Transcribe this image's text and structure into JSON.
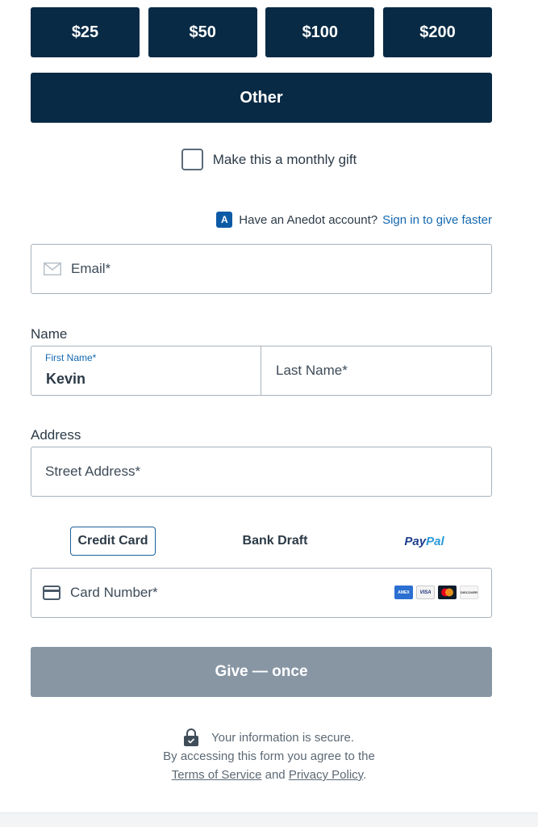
{
  "amounts": [
    "$25",
    "$50",
    "$100",
    "$200"
  ],
  "other_label": "Other",
  "monthly_label": "Make this a monthly gift",
  "account": {
    "badge": "A",
    "prompt": "Have an Anedot account?",
    "signin": "Sign in to give faster"
  },
  "email": {
    "placeholder": "Email*"
  },
  "name": {
    "label": "Name",
    "first_label": "First Name*",
    "first_value": "Kevin",
    "last_placeholder": "Last Name*"
  },
  "address": {
    "label": "Address",
    "street_placeholder": "Street Address*"
  },
  "payment_methods": {
    "credit_card": "Credit Card",
    "bank_draft": "Bank Draft",
    "paypal_pay": "Pay",
    "paypal_pal": "Pal"
  },
  "card": {
    "placeholder": "Card Number*",
    "brands": [
      "AMEX",
      "VISA",
      "mastercard-icon",
      "DISCOVER"
    ]
  },
  "give_label": "Give — once",
  "secure_text": "Your information is secure.",
  "agree_text": "By accessing this form you agree to the",
  "terms_link": "Terms of Service",
  "and_text": "and",
  "privacy_link": "Privacy Policy",
  "period": ".",
  "colors": {
    "navy": "#082a45",
    "link": "#1368b0",
    "disabled_button": "#8896a4"
  }
}
